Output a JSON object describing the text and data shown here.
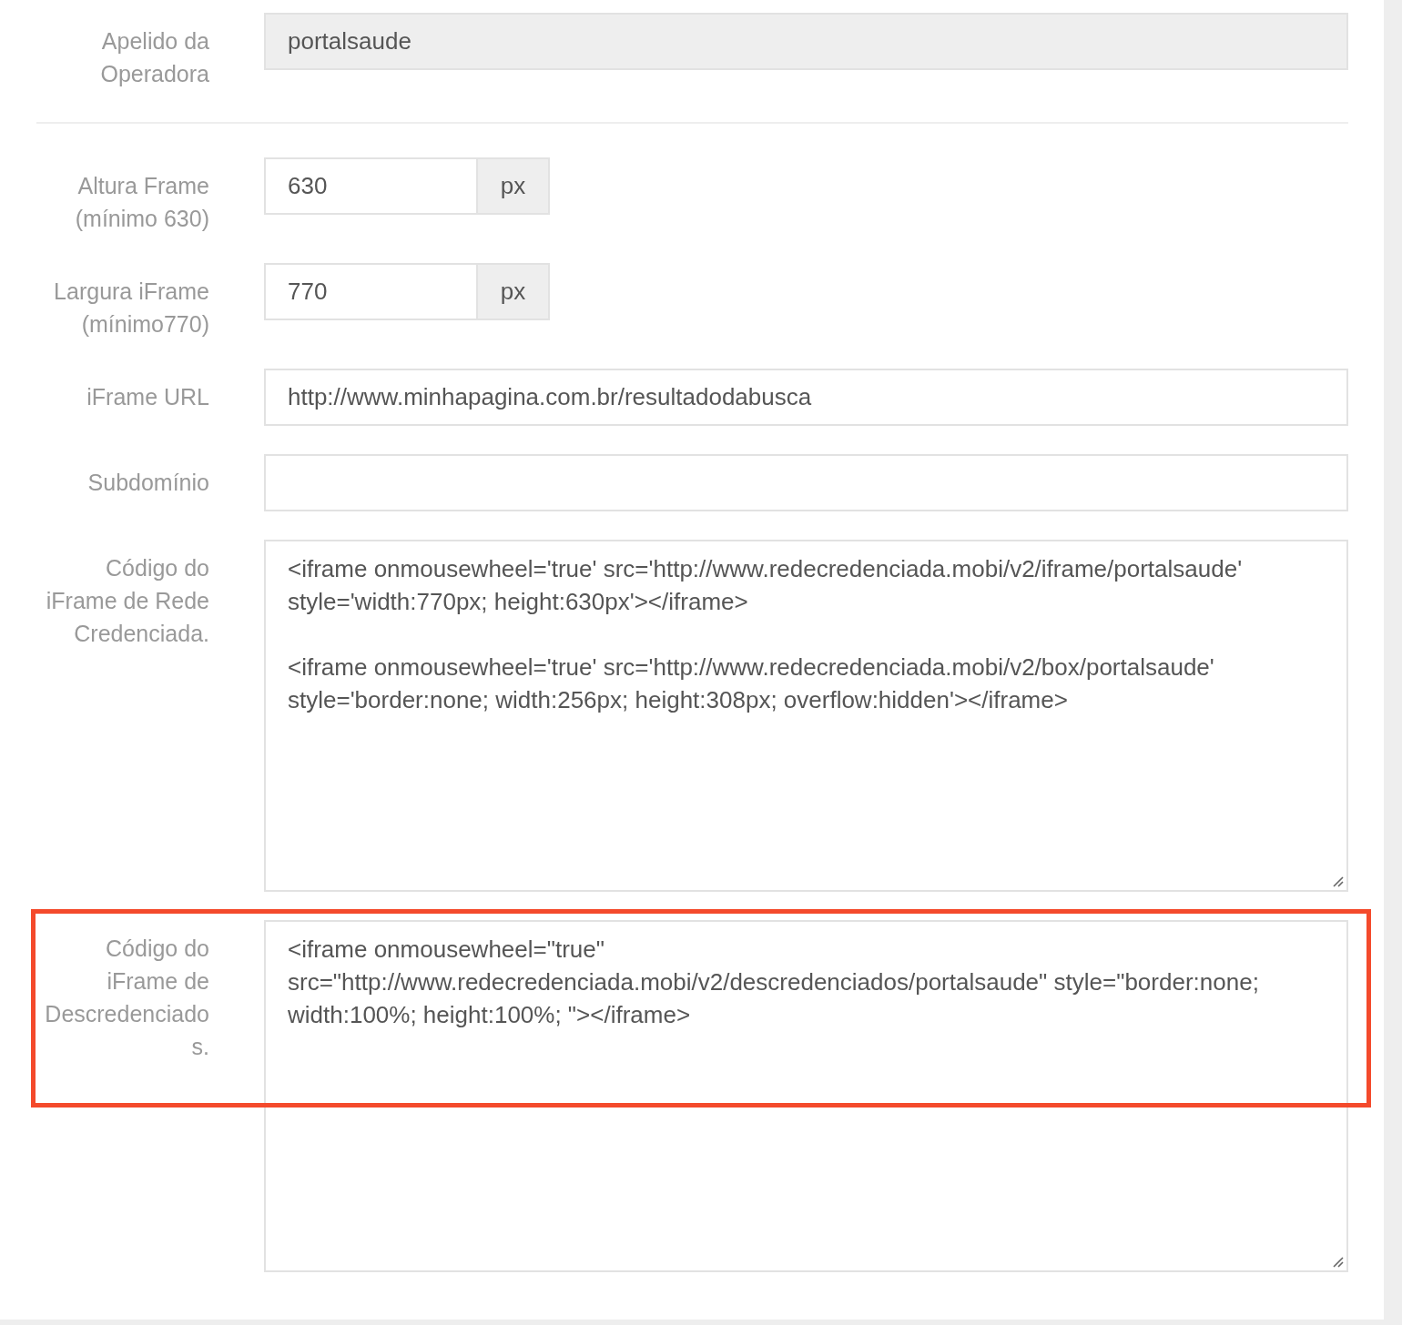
{
  "sections": [
    {
      "fields": [
        {
          "kind": "text",
          "label": "Apelido da Operadora",
          "value": "portalsaude",
          "readonly": true,
          "highlighted": false
        }
      ]
    },
    {
      "fields": [
        {
          "kind": "addon",
          "label": "Altura Frame (mínimo 630)",
          "value": "630",
          "addon": "px",
          "readonly": false,
          "highlighted": false
        },
        {
          "kind": "addon",
          "label": "Largura iFrame (mínimo770)",
          "value": "770",
          "addon": "px",
          "readonly": false,
          "highlighted": false
        },
        {
          "kind": "text",
          "label": "iFrame URL",
          "value": "http://www.minhapagina.com.br/resultadodabusca",
          "readonly": false,
          "highlighted": false
        },
        {
          "kind": "text",
          "label": "Subdomínio",
          "readonly": false,
          "highlighted": false
        },
        {
          "kind": "textarea",
          "label": "Código do iFrame de Rede Credenciada.",
          "value": "<iframe onmousewheel='true' src='http://www.redecredenciada.mobi/v2/iframe/portalsaude' style='width:770px; height:630px'></iframe>\n\n<iframe onmousewheel='true' src='http://www.redecredenciada.mobi/v2/box/portalsaude' style='border:none; width:256px; height:308px; overflow:hidden'></iframe>",
          "readonly": false,
          "highlighted": false
        },
        {
          "kind": "textarea",
          "label": "Código do iFrame de Descredenciados.",
          "value": "<iframe onmousewheel=\"true\" src=\"http://www.redecredenciada.mobi/v2/descredenciados/portalsaude\" style=\"border:none; width:100%; height:100%; \"></iframe>",
          "readonly": false,
          "highlighted": true
        }
      ]
    }
  ]
}
